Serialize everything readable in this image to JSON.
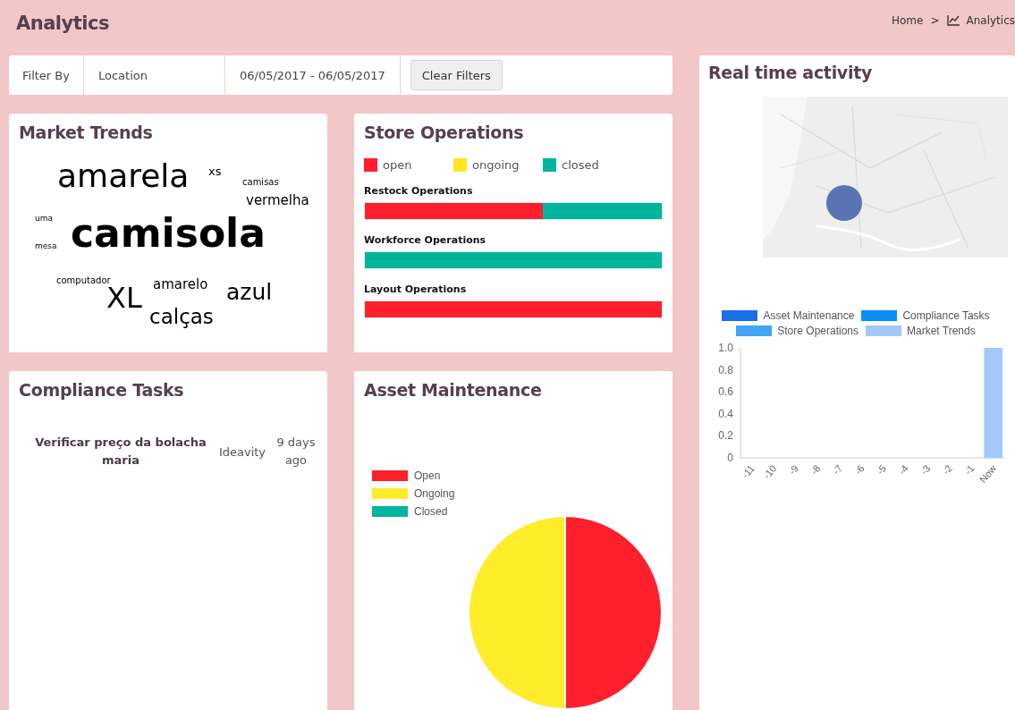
{
  "header": {
    "title": "Analytics",
    "breadcrumb": [
      "Home",
      ">",
      "Analytics"
    ]
  },
  "filters": {
    "label": "Filter By",
    "location": "Location",
    "date_range": "06/05/2017 - 06/05/2017",
    "clear_button": "Clear Filters"
  },
  "market_trends": {
    "title": "Market Trends",
    "words": [
      {
        "text": "amarela"
      },
      {
        "text": "xs"
      },
      {
        "text": "camisas"
      },
      {
        "text": "vermelha"
      },
      {
        "text": "uma"
      },
      {
        "text": "mesa"
      },
      {
        "text": "camisola"
      },
      {
        "text": "computador"
      },
      {
        "text": "XL"
      },
      {
        "text": "amarelo"
      },
      {
        "text": "calças"
      },
      {
        "text": "azul"
      }
    ]
  },
  "store_operations": {
    "title": "Store Operations",
    "legend": [
      {
        "label": "open",
        "color": "#ff1f2d"
      },
      {
        "label": "ongoing",
        "color": "#ffe61f"
      },
      {
        "label": "closed",
        "color": "#00b59c"
      }
    ],
    "bars": [
      {
        "label": "Restock Operations",
        "level": 0.6
      },
      {
        "label": "Workforce Operations",
        "level": 0
      },
      {
        "label": "Layout Operations",
        "level": 1
      }
    ]
  },
  "compliance_tasks": {
    "title": "Compliance Tasks",
    "tasks": [
      {
        "name": "Verificar preço da bolacha maria",
        "owner": "Ideavity",
        "age": "9 days ago"
      }
    ]
  },
  "asset_maintenance": {
    "title": "Asset Maintenance",
    "chart_data": {
      "type": "pie",
      "categories": [
        "Open",
        "Ongoing",
        "Closed"
      ],
      "values": [
        50,
        50,
        0
      ],
      "colors": [
        "#ff1f2d",
        "#ffec2b",
        "#00b59c"
      ],
      "legend": "left"
    }
  },
  "real_time_activity": {
    "title": "Real time activity",
    "chart_data": {
      "type": "bar",
      "stacked": true,
      "categories": [
        "-11",
        "-10",
        "-9",
        "-8",
        "-7",
        "-6",
        "-5",
        "-4",
        "-3",
        "-2",
        "-1",
        "Now"
      ],
      "series": [
        {
          "name": "Asset Maintenance",
          "color": "#1a6fe6",
          "values": [
            0,
            0,
            0,
            0,
            0,
            0,
            0,
            0,
            0,
            0,
            0,
            0
          ]
        },
        {
          "name": "Compliance Tasks",
          "color": "#0b8ff5",
          "values": [
            0,
            0,
            0,
            0,
            0,
            0,
            0,
            0,
            0,
            0,
            0,
            0
          ]
        },
        {
          "name": "Store Operations",
          "color": "#41a6f5",
          "values": [
            0,
            0,
            0,
            0,
            0,
            0,
            0,
            0,
            0,
            0,
            0,
            0
          ]
        },
        {
          "name": "Market Trends",
          "color": "#a3c9fb",
          "values": [
            0,
            0,
            0,
            0,
            0,
            0,
            0,
            0,
            0,
            0,
            0,
            1
          ]
        }
      ],
      "ylim": [
        0,
        1
      ],
      "yticks": [
        {
          "value": 0,
          "label": "0"
        },
        0.2,
        0.4,
        0.6,
        0.8,
        {
          "value": 1,
          "label": "1.0"
        }
      ]
    }
  }
}
